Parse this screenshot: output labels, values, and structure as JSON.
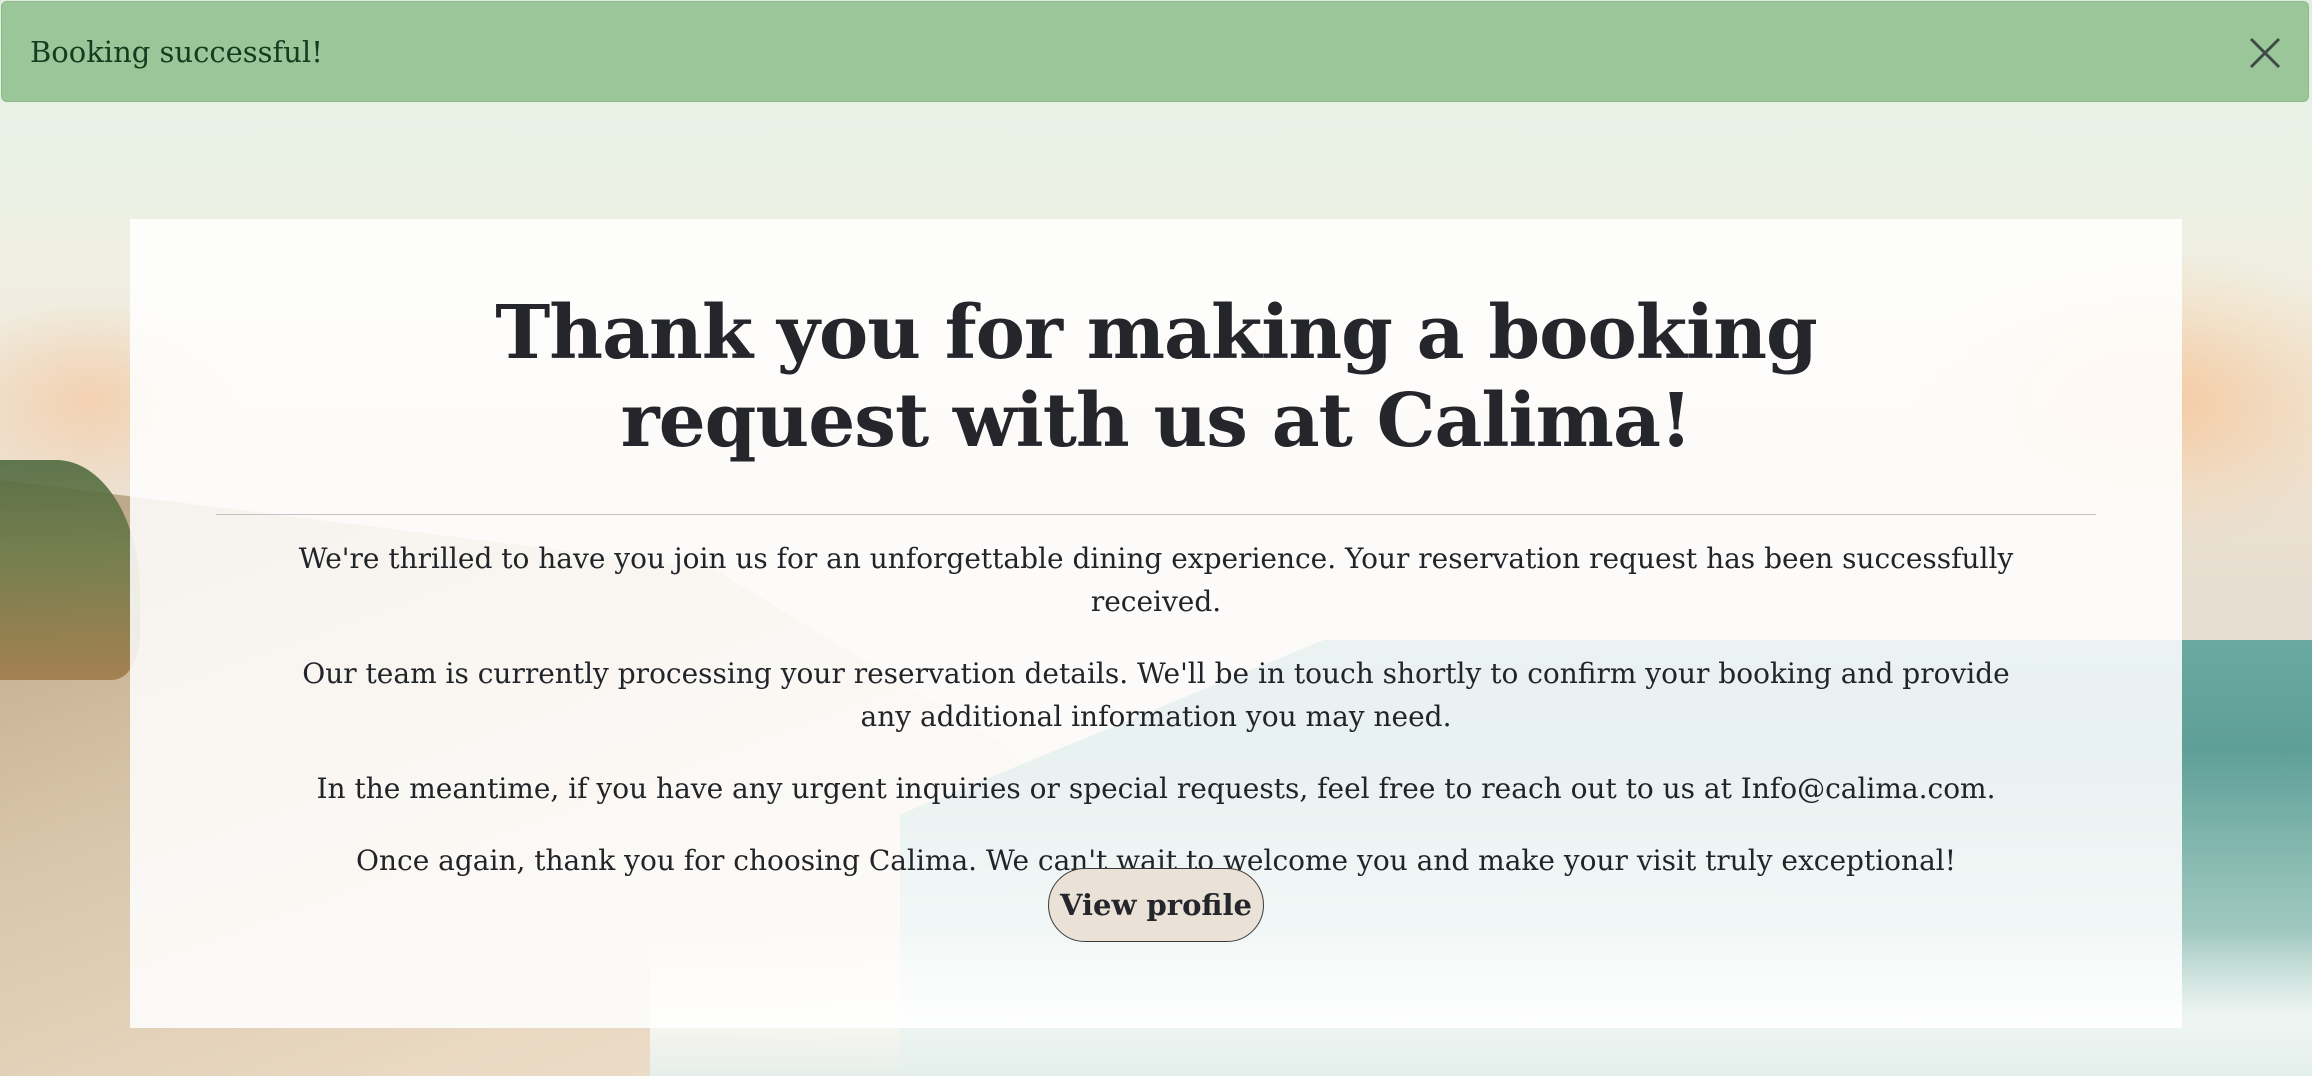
{
  "alert": {
    "message": "Booking successful!",
    "close_icon": "close-icon",
    "background_color": "#9bc69a"
  },
  "confirmation": {
    "title": "Thank you for making a booking request with us at Calima!",
    "paragraphs": [
      "We're thrilled to have you join us for an unforgettable dining experience. Your reservation request has been successfully received.",
      "Our team is currently processing your reservation details. We'll be in touch shortly to confirm your booking and provide any additional information you may need.",
      "In the meantime, if you have any urgent inquiries or special requests, feel free to reach out to us at Info@calima.com.",
      "Once again, thank you for choosing Calima. We can't wait to welcome you and make your visit truly exceptional!"
    ],
    "button_label": "View profile",
    "button_color": "#eae1d7"
  }
}
